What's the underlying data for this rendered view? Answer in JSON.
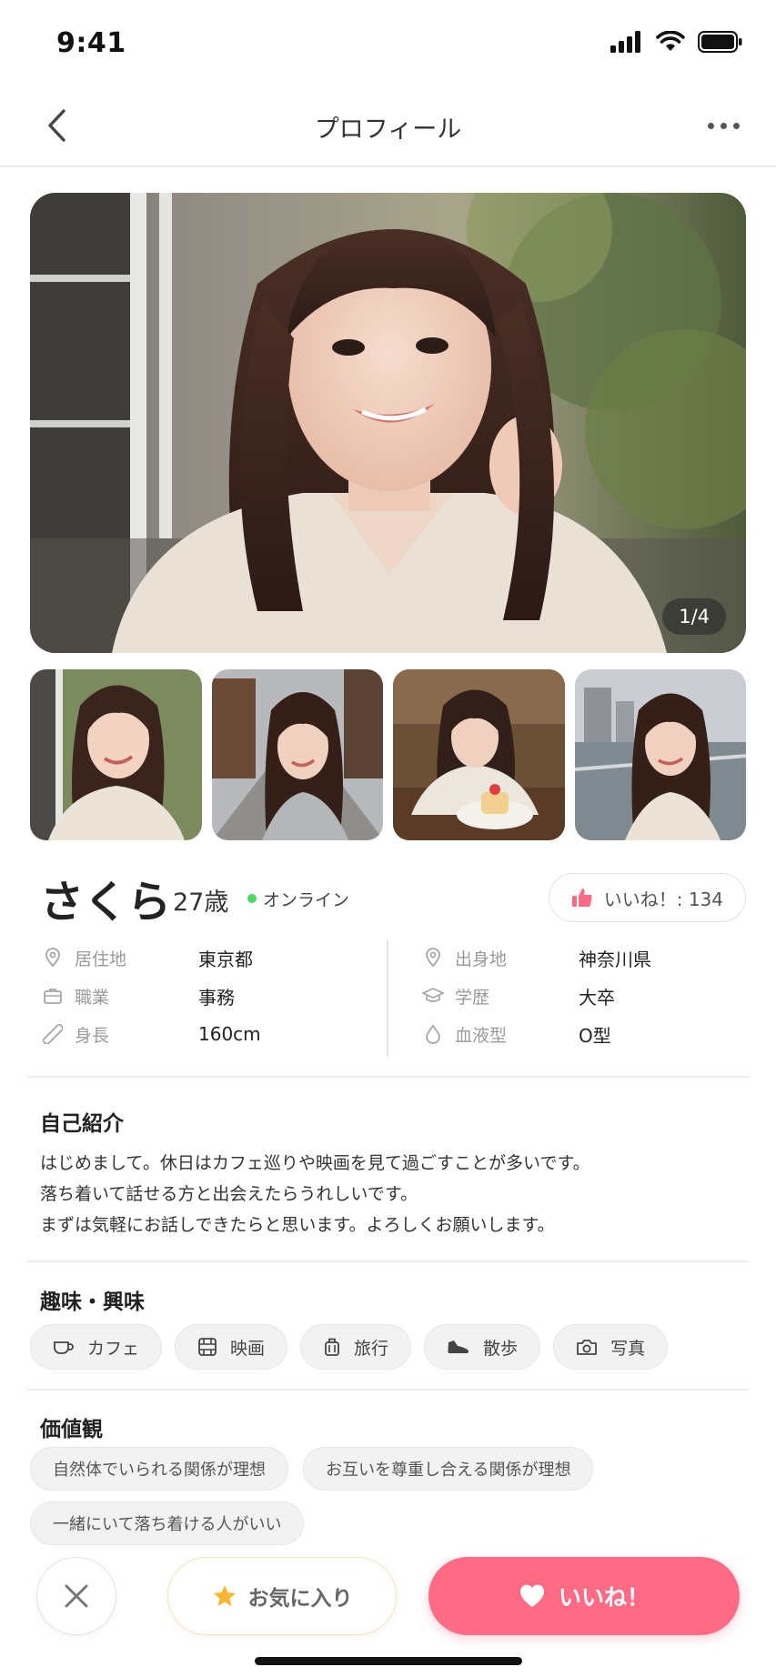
{
  "status_bar": {
    "time": "9:41"
  },
  "nav": {
    "title": "プロフィール"
  },
  "photos": {
    "counter": "1/4"
  },
  "profile": {
    "name": "さくら",
    "age": "27歳",
    "online": "オンライン",
    "like_label": "いいね！: 134"
  },
  "info": {
    "left": [
      {
        "icon": "location-pin-icon",
        "label": "居住地",
        "value": "東京都"
      },
      {
        "icon": "briefcase-icon",
        "label": "職業",
        "value": "事務"
      },
      {
        "icon": "ruler-icon",
        "label": "身長",
        "value": "160cm"
      }
    ],
    "right": [
      {
        "icon": "location-pin-icon",
        "label": "出身地",
        "value": "神奈川県"
      },
      {
        "icon": "graduation-cap-icon",
        "label": "学歴",
        "value": "大卒"
      },
      {
        "icon": "drop-icon",
        "label": "血液型",
        "value": "O型"
      }
    ]
  },
  "intro": {
    "title": "自己紹介",
    "lines": [
      "はじめまして。休日はカフェ巡りや映画を見て過ごすことが多いです。",
      "落ち着いて話せる方と出会えたらうれしいです。",
      "まずは気軽にお話しできたらと思います。よろしくお願いします。"
    ]
  },
  "hobbies": {
    "title": "趣味・興味",
    "items": [
      {
        "icon": "coffee-cup-icon",
        "label": "カフェ"
      },
      {
        "icon": "film-icon",
        "label": "映画"
      },
      {
        "icon": "suitcase-icon",
        "label": "旅行"
      },
      {
        "icon": "shoe-icon",
        "label": "散歩"
      },
      {
        "icon": "camera-icon",
        "label": "写真"
      }
    ]
  },
  "values": {
    "title": "価値観",
    "items": [
      "自然体でいられる関係が理想",
      "お互いを尊重し合える関係が理想",
      "一緒にいて落ち着ける人がいい"
    ]
  },
  "actions": {
    "favorite": "お気に入り",
    "like": "いいね！"
  },
  "colors": {
    "accent": "#ff6b85",
    "online": "#4cd964",
    "star": "#f7b733"
  }
}
